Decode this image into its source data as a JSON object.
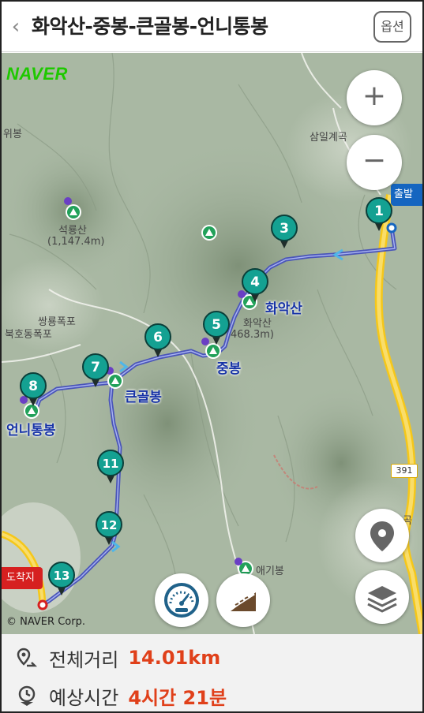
{
  "header": {
    "back_icon": "chevron-left-icon",
    "title": "화악산-중봉-큰골봉-언니통봉",
    "option_label": "옵션"
  },
  "map": {
    "brand": "NAVER",
    "copyright": "© NAVER Corp.",
    "start_label": "출발",
    "end_label": "도착지",
    "road_number": "391",
    "places": {
      "p1": "삼일계곡",
      "p2": "석룡산",
      "p3": "(1,147.4m)",
      "p4": "쌍룡폭포",
      "p5": "북호동폭포",
      "p6": "애기봉",
      "p7": "위봉",
      "p8": "468.3m)",
      "p9": "화악산",
      "p10": "곡"
    },
    "peaks": {
      "hwaak": "화악산",
      "jungbong": "중봉",
      "keungolbong": "큰골봉",
      "eonnitongbong": "언니통봉"
    },
    "waypoints": [
      "1",
      "3",
      "4",
      "5",
      "6",
      "7",
      "8",
      "11",
      "12",
      "13"
    ],
    "controls": {
      "zoom_in": "+",
      "zoom_out": "−"
    }
  },
  "summary": {
    "distance_label": "전체거리",
    "distance_value": "14.01km",
    "time_label": "예상시간",
    "time_value": "4시간 21분"
  },
  "colors": {
    "route": "#4a55b8",
    "marker": "#14a192",
    "highway": "#f5c71a",
    "accent": "#e0401a",
    "naver": "#1ec800"
  }
}
